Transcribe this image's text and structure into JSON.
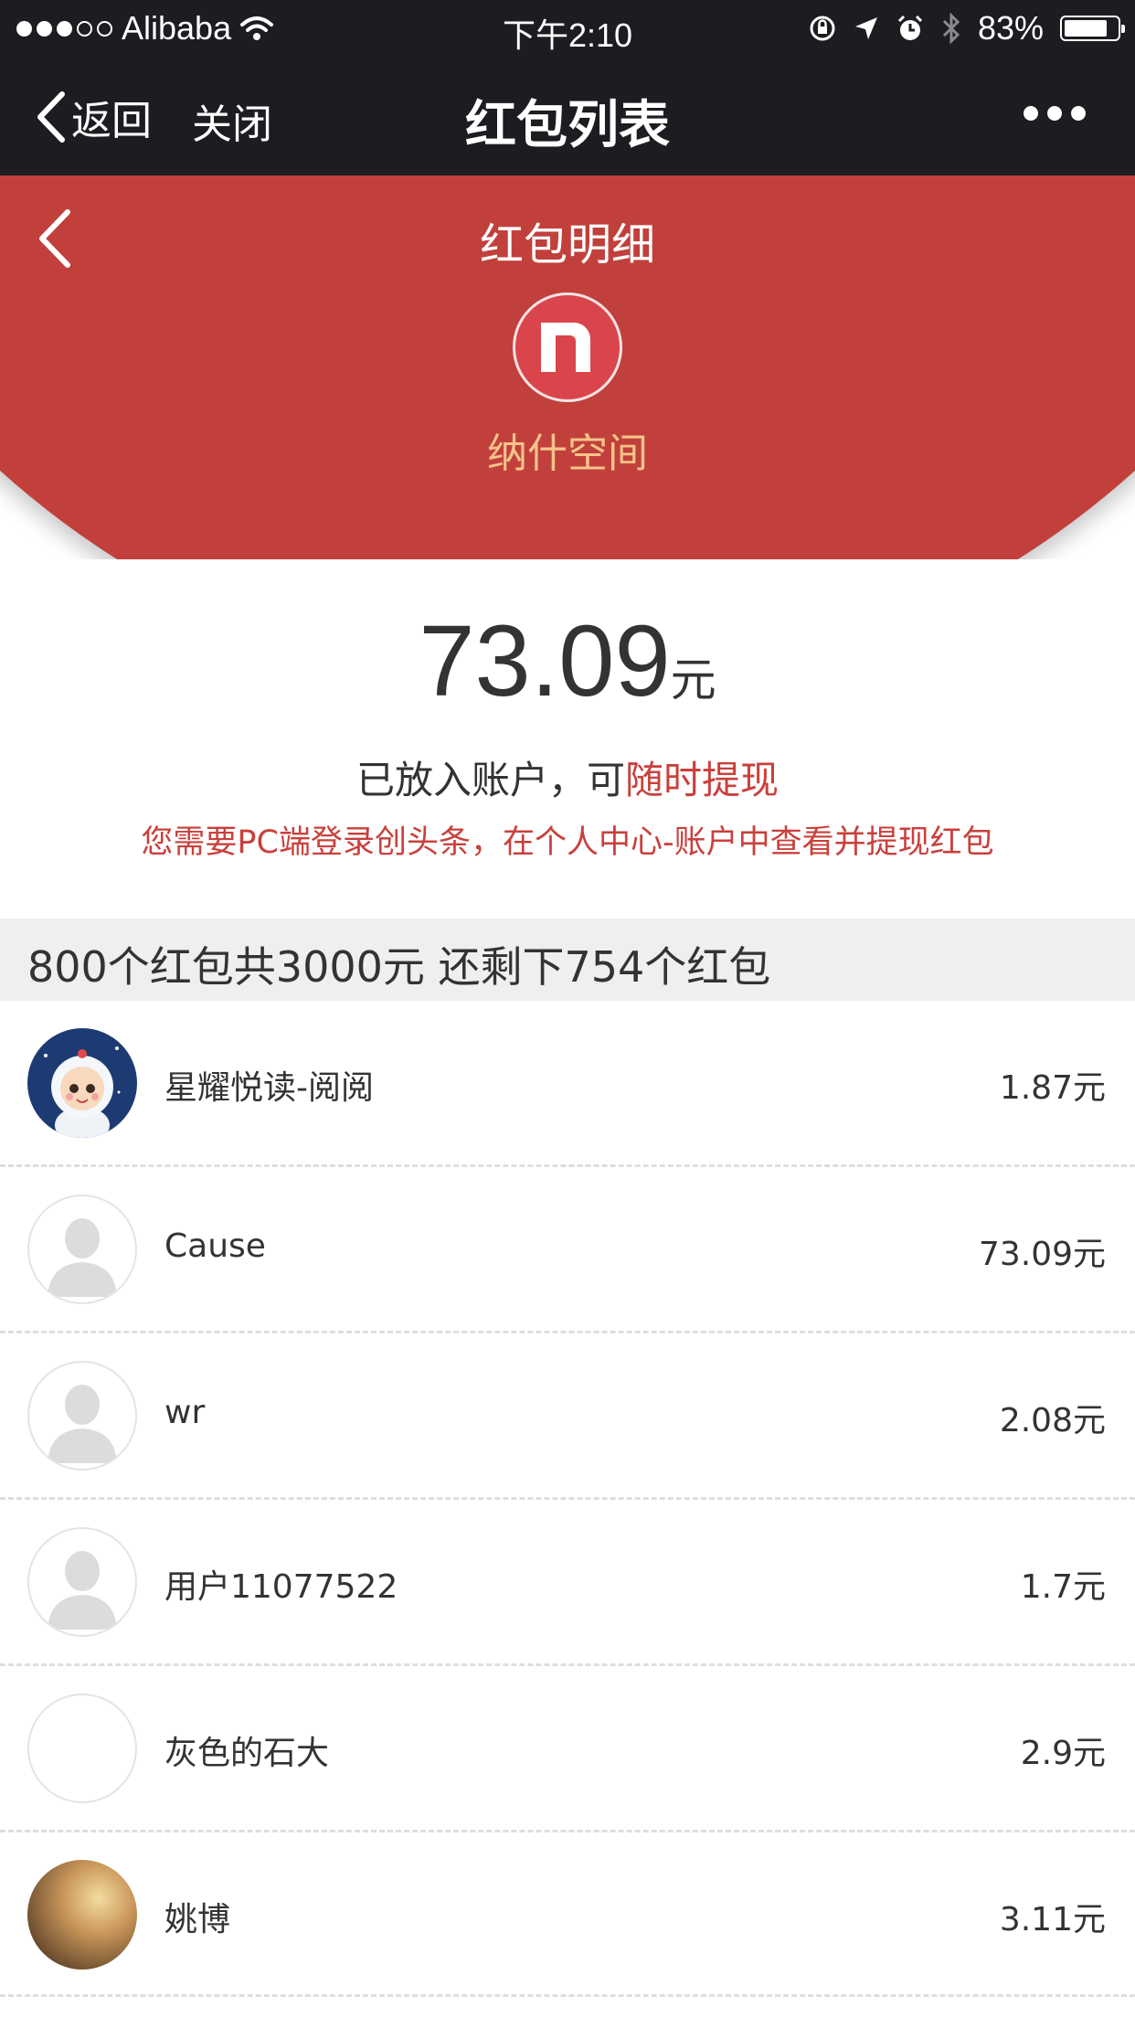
{
  "status_bar": {
    "carrier": "Alibaba",
    "time": "下午2:10",
    "battery": "83%",
    "battery_level": 0.83,
    "signal_bars": 3,
    "signal_total": 5
  },
  "nav": {
    "back_label": "返回",
    "close_label": "关闭",
    "title": "红包列表"
  },
  "header": {
    "title": "红包明细",
    "org_name": "纳什空间",
    "accent_color": "#c1403c"
  },
  "amount": {
    "value": "73.09",
    "unit": "元"
  },
  "account": {
    "text": "已放入账户，可",
    "link": "随时提现",
    "notice": "您需要PC端登录创头条，在个人中心-账户中查看并提现红包"
  },
  "summary": "800个红包共3000元 还剩下754个红包",
  "list": [
    {
      "name": "星耀悦读-阅阅",
      "amount": "1.87元",
      "avatar": "astronaut"
    },
    {
      "name": "Cause",
      "amount": "73.09元",
      "avatar": "default"
    },
    {
      "name": "wr",
      "amount": "2.08元",
      "avatar": "default"
    },
    {
      "name": "用户11077522",
      "amount": "1.7元",
      "avatar": "default"
    },
    {
      "name": "灰色的石大",
      "amount": "2.9元",
      "avatar": "blank"
    },
    {
      "name": "姚博",
      "amount": "3.11元",
      "avatar": "photo"
    }
  ]
}
